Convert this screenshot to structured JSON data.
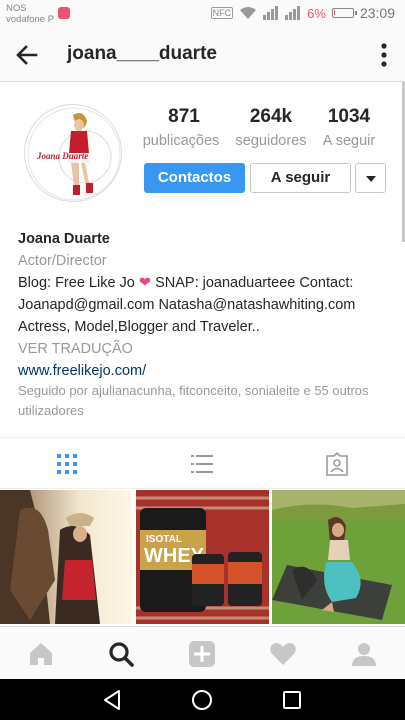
{
  "status_bar": {
    "carrier_line1": "NOS",
    "carrier_line2": "vodafone P",
    "nfc": "NFC",
    "battery": "6%",
    "battery_level": 0.06,
    "time": "23:09"
  },
  "header": {
    "username": "joana____duarte"
  },
  "profile": {
    "stats": [
      {
        "value": "871",
        "label": "publicações"
      },
      {
        "value": "264k",
        "label": "seguidores"
      },
      {
        "value": "1034",
        "label": "A seguir"
      }
    ],
    "contact_label": "Contactos",
    "follow_label": "A seguir",
    "avatar_text": "Joana Duarte"
  },
  "bio": {
    "name": "Joana Duarte",
    "category": "Actor/Director",
    "line1_pre": "Blog: Free Like Jo ",
    "heart": "❤",
    "line1_post": " SNAP: joanaduarteee Contact:",
    "line2": "Joanapd@gmail.com Natasha@natashawhiting.com",
    "line3": "Actress, Model,Blogger and Traveler..",
    "translate": "VER TRADUÇÃO",
    "link": "www.freelikejo.com/",
    "followed_by": "Seguido por ajulianacunha, fitconceito, sonialeite e 55 outros utilizadores"
  },
  "grid": {
    "post2_text1": "ISOTAL",
    "post2_text2": "WHEY"
  },
  "colors": {
    "accent": "#3897f0",
    "heart": "#e8468a",
    "link": "#003569"
  }
}
